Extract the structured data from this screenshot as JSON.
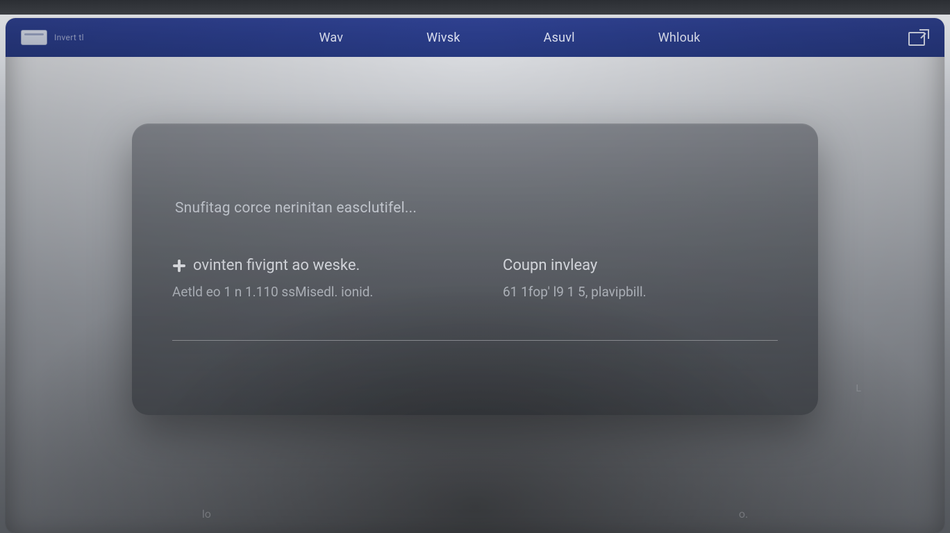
{
  "header": {
    "brand_label": "Invert tl",
    "nav": [
      "Wav",
      "Wivsk",
      "Asuvl",
      "Whlouk"
    ]
  },
  "card": {
    "status": "Snufitag corce nerinitan easclutifel...",
    "left": {
      "title": "ovinten fivignt ao weske.",
      "sub": "Aetld eo 1 n 1.110 ssMisedl. ionid."
    },
    "right": {
      "title": "Coupn invleay",
      "sub": "61 1fop' l9 1 5, plavipbill."
    }
  },
  "pager": {
    "left": "lo",
    "right": "o."
  },
  "floating": "L"
}
